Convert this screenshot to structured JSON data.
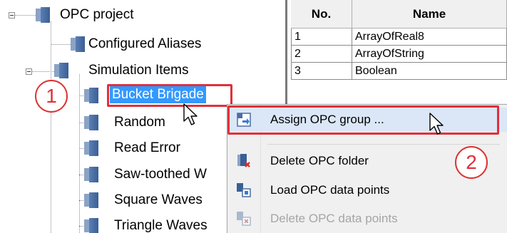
{
  "tree": {
    "root": "OPC project",
    "items": [
      {
        "label": "Configured Aliases"
      },
      {
        "label": "Simulation Items"
      },
      {
        "label": "Bucket Brigade"
      },
      {
        "label": "Random"
      },
      {
        "label": "Read Error"
      },
      {
        "label": "Saw-toothed W"
      },
      {
        "label": "Square Waves"
      },
      {
        "label": "Triangle Waves"
      }
    ]
  },
  "table": {
    "headers": [
      "No.",
      "Name"
    ],
    "rows": [
      {
        "no": "1",
        "name": "ArrayOfReal8"
      },
      {
        "no": "2",
        "name": "ArrayOfString"
      },
      {
        "no": "3",
        "name": "Boolean"
      }
    ]
  },
  "menu": {
    "items": [
      {
        "label": "Assign OPC group ...",
        "icon": "assign-group-icon"
      },
      {
        "label": "Delete OPC folder",
        "icon": "delete-folder-icon"
      },
      {
        "label": "Load OPC data points",
        "icon": "load-data-points-icon"
      },
      {
        "label": "Delete OPC data points",
        "icon": "delete-data-points-icon"
      }
    ]
  },
  "callouts": {
    "first": "1",
    "second": "2"
  },
  "colors": {
    "highlight_box": "#e0303a",
    "selection": "#3399ff",
    "node_icon": "#3a5f94"
  }
}
